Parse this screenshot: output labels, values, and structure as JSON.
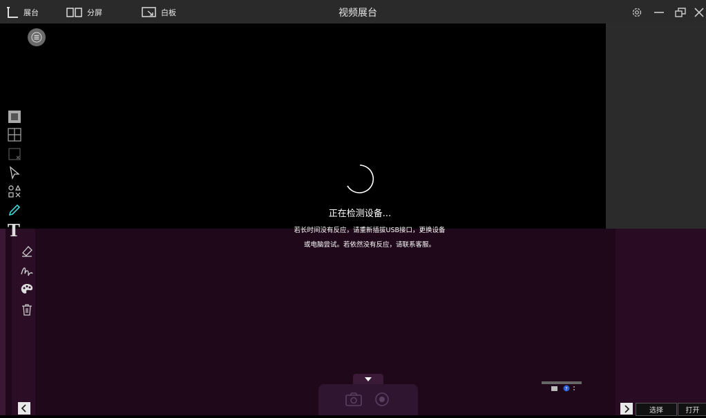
{
  "titlebar": {
    "title": "视频展台",
    "tabs": [
      {
        "label": "展台",
        "icon": "booth-icon"
      },
      {
        "label": "分屏",
        "icon": "split-screen-icon"
      },
      {
        "label": "白板",
        "icon": "whiteboard-icon"
      }
    ],
    "controls": [
      "settings-icon",
      "minimize-icon",
      "restore-icon",
      "close-icon"
    ]
  },
  "status": {
    "main": "正在检测设备...",
    "line1": "若长时间没有反应，请重新插拔USB接口，更换设备",
    "line2": "或电脑尝试。若依然没有反应，请联系客服。"
  },
  "tools": [
    "grid-pattern-icon",
    "layout-grid-icon",
    "crop-icon",
    "cursor-icon",
    "shapes-icon",
    "pen-icon",
    "text-icon",
    "eraser-icon",
    "stroke-icon",
    "palette-icon",
    "trash-icon"
  ],
  "accent": "#41d4d8",
  "bottom": {
    "select_label": "选择",
    "open_label": "打开"
  }
}
